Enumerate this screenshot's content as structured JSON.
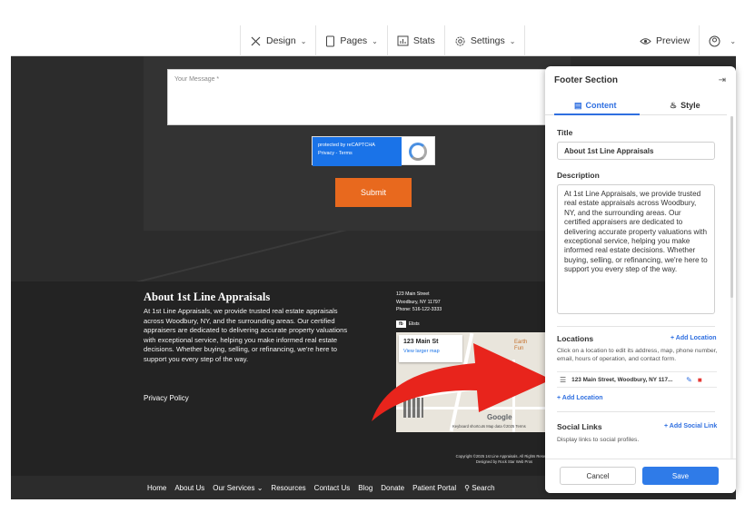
{
  "toolbar": {
    "design_label": "Design",
    "pages_label": "Pages",
    "stats_label": "Stats",
    "settings_label": "Settings",
    "preview_label": "Preview"
  },
  "form": {
    "message_placeholder": "Your Message *",
    "captcha_line1": "protected by reCAPTCHA",
    "captcha_line2": "Privacy - Terms",
    "submit_label": "Submit"
  },
  "site_footer": {
    "title": "About 1st Line Appraisals",
    "description": "At 1st Line Appraisals, we provide trusted real estate appraisals across Woodbury, NY, and the surrounding areas. Our certified appraisers are dedicated to delivering accurate property valuations with exceptional service, helping you make informed real estate decisions. Whether buying, selling, or refinancing, we're here to support you every step of the way.",
    "privacy_label": "Privacy Policy",
    "address_line1": "123 Main Street",
    "address_line2": "Woodbury, NY 11797",
    "phone": "Phone: 516-122-3333",
    "social_fb": "fb",
    "social_yelp": "Elists",
    "map_card_title": "123 Main St",
    "map_card_link": "View larger map",
    "map_place": "Earth\nFun",
    "map_google": "Google",
    "map_terms": "Keyboard shortcuts   Map data ©2025   Terms",
    "copyright_line1": "Copyright ©2025 1st Line Appraisals. All Rights Reserved",
    "copyright_line2": "Designed by Rock Star Web Pros"
  },
  "nav": {
    "items": [
      "Home",
      "About Us",
      "Our Services",
      "Resources",
      "Contact Us",
      "Blog",
      "Donate",
      "Patient Portal",
      "Search"
    ]
  },
  "panel": {
    "header": "Footer Section",
    "tab_content": "Content",
    "tab_style": "Style",
    "title_label": "Title",
    "title_value": "About 1st Line Appraisals",
    "description_label": "Description",
    "description_value": "At 1st Line Appraisals, we provide trusted real estate appraisals across Woodbury, NY, and the surrounding areas. Our certified appraisers are dedicated to delivering accurate property valuations with exceptional service, helping you make informed real estate decisions. Whether buying, selling, or refinancing, we're here to support you every step of the way.",
    "locations_label": "Locations",
    "add_location_link": "+ Add Location",
    "locations_help": "Click on a location to edit its address, map, phone number, email, hours of operation, and contact form.",
    "location_item": "123 Main Street, Woodbury, NY 117...",
    "add_location_bottom": "+ Add Location",
    "social_label": "Social Links",
    "add_social_link": "+ Add Social Link",
    "social_help": "Display links to social profiles.",
    "cancel_label": "Cancel",
    "save_label": "Save"
  },
  "colors": {
    "accent": "#2f6fe0",
    "submit": "#e8691e",
    "arrow": "#e8241c",
    "dark_bg": "#2c2c2c"
  }
}
